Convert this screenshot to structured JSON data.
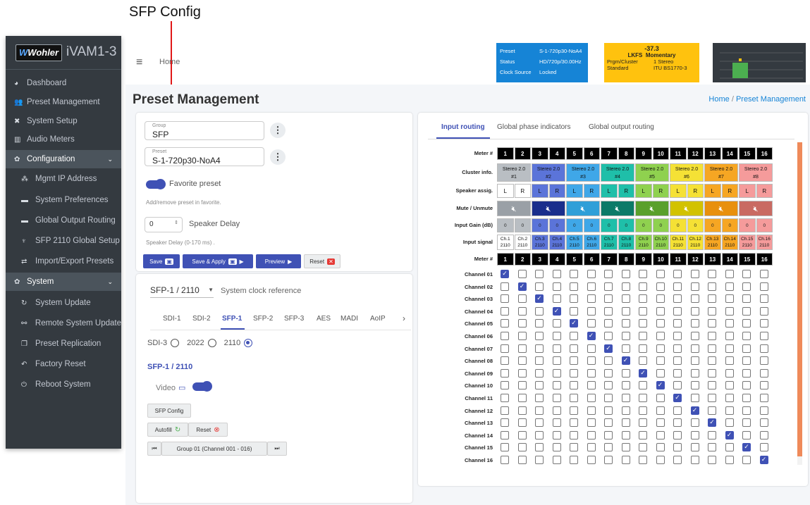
{
  "callout": {
    "title": "SFP Config"
  },
  "sidebar": {
    "brand_logo": "Wohler",
    "app_name": "iVAM1-3",
    "items": [
      {
        "label": "Dashboard",
        "icon": "dashboard-icon",
        "glyph": "◕"
      },
      {
        "label": "Preset Management",
        "icon": "users-icon",
        "glyph": "👥"
      },
      {
        "label": "System Setup",
        "icon": "tools-icon",
        "glyph": "✖"
      },
      {
        "label": "Audio Meters",
        "icon": "meter-icon",
        "glyph": "▥"
      },
      {
        "label": "Configuration",
        "icon": "gear-icon",
        "glyph": "✿",
        "chevron": "⌄"
      },
      {
        "label": "Mgmt IP Address",
        "icon": "network-icon",
        "glyph": "⁂"
      },
      {
        "label": "System Preferences",
        "icon": "keyboard-icon",
        "glyph": "▬"
      },
      {
        "label": "Global Output Routing",
        "icon": "keyboard-icon",
        "glyph": "▬"
      },
      {
        "label": "SFP 2110 Global Setup",
        "icon": "plug-icon",
        "glyph": "♆"
      },
      {
        "label": "Import/Export Presets",
        "icon": "exchange-icon",
        "glyph": "⇄"
      },
      {
        "label": "System",
        "icon": "cogs-icon",
        "glyph": "✿",
        "chevron": "⌄"
      },
      {
        "label": "System Update",
        "icon": "sync-icon",
        "glyph": "↻"
      },
      {
        "label": "Remote System Update",
        "icon": "network-wired-icon",
        "glyph": "⚯"
      },
      {
        "label": "Preset Replication",
        "icon": "copy-icon",
        "glyph": "❐"
      },
      {
        "label": "Factory Reset",
        "icon": "undo-icon",
        "glyph": "↶"
      },
      {
        "label": "Reboot System",
        "icon": "power-icon",
        "glyph": "⏻"
      }
    ]
  },
  "topbar": {
    "home": "Home"
  },
  "status_panel": {
    "rows": [
      {
        "k": "Preset",
        "v": "S-1-720p30-NoA4"
      },
      {
        "k": "Status",
        "v": "HD/720p/30.00Hz"
      },
      {
        "k": "Clock Source",
        "v": "Locked"
      }
    ],
    "color": "#1684d6"
  },
  "loudness_panel": {
    "value": "-37.3",
    "unit": "LKFS",
    "mode": "Momentary",
    "program_label": "Prgm/Cluster",
    "program_value": "1  Stereo",
    "standard_label": "Standard",
    "standard_value": "ITU BS1770-3",
    "color": "#ffc20e"
  },
  "page": {
    "title": "Preset Management",
    "breadcrumb_home": "Home",
    "breadcrumb_sep": "/",
    "breadcrumb_current": "Preset Management"
  },
  "preset_form": {
    "group_label": "Group",
    "group_value": "SFP",
    "preset_label": "Preset",
    "preset_value": "S-1-720p30-NoA4",
    "favorite_label": "Favorite preset",
    "favorite_hint": "Add/remove preset in favorite.",
    "delay_value": "0",
    "delay_label": "Speaker Delay",
    "delay_hint": "Speaker Delay (0-170 ms) .",
    "save": "Save",
    "save_apply": "Save & Apply",
    "preview": "Preview",
    "reset": "Reset"
  },
  "input_config": {
    "clock_value": "SFP-1 / 2110",
    "clock_label": "System clock reference",
    "tabs": [
      "SDI-1",
      "SDI-2",
      "SFP-1",
      "SFP-2",
      "SFP-3",
      "AES",
      "MADI",
      "AoIP"
    ],
    "active_tab": "SFP-1",
    "radios": [
      "SDI-3",
      "2022",
      "2110"
    ],
    "selected_radio": "2110",
    "section_title": "SFP-1 / 2110",
    "video_label": "Video",
    "sfp_config": "SFP Config",
    "autofill": "Autofill",
    "reset": "Reset",
    "pager_label": "Group 01 (Channel 001 - 016)"
  },
  "routing": {
    "tabs": [
      "Input routing",
      "Global phase indicators",
      "Global output routing"
    ],
    "active_tab": "Input routing",
    "row_labels": {
      "meter": "Meter #",
      "cluster": "Cluster info.",
      "speaker": "Speaker assig.",
      "mute": "Mute / Unmute",
      "gain": "Input Gain (dB)",
      "signal": "Input signal",
      "meter2": "Meter #"
    },
    "meters": [
      "1",
      "2",
      "3",
      "4",
      "5",
      "6",
      "7",
      "8",
      "9",
      "10",
      "11",
      "12",
      "13",
      "14",
      "15",
      "16"
    ],
    "clusters": [
      {
        "name": "Stereo 2.0",
        "num": "#1",
        "color": "#b9bec3"
      },
      {
        "name": "Stereo 2.0",
        "num": "#2",
        "color": "#5b74d9"
      },
      {
        "name": "Stereo 2.0",
        "num": "#3",
        "color": "#3fa7e8"
      },
      {
        "name": "Stereo 2.0",
        "num": "#4",
        "color": "#1fbfa9"
      },
      {
        "name": "Stereo 2.0",
        "num": "#5",
        "color": "#8fd14f"
      },
      {
        "name": "Stereo 2.0",
        "num": "#6",
        "color": "#f5e135"
      },
      {
        "name": "Stereo 2.0",
        "num": "#7",
        "color": "#f6a623"
      },
      {
        "name": "Stereo 2.0",
        "num": "#8",
        "color": "#f59b9b"
      }
    ],
    "speakers": [
      "L",
      "R",
      "L",
      "R",
      "L",
      "R",
      "L",
      "R",
      "L",
      "R",
      "L",
      "R",
      "L",
      "R",
      "L",
      "R"
    ],
    "mute_colors": [
      "#9aa0a6",
      "#1a2e8c",
      "#2f9fd8",
      "#0c7a68",
      "#5aa02c",
      "#d2c200",
      "#e8900d",
      "#c96a62"
    ],
    "gains": [
      "0",
      "0",
      "0",
      "0",
      "0",
      "0",
      "0",
      "0",
      "0",
      "0",
      "0",
      "0",
      "0",
      "0",
      "0",
      "0"
    ],
    "signals": [
      "Ch.1",
      "Ch.2",
      "Ch.3",
      "Ch.4",
      "Ch.5",
      "Ch.6",
      "Ch.7",
      "Ch.8",
      "Ch.9",
      "Ch.10",
      "Ch.11",
      "Ch.12",
      "Ch.13",
      "Ch.14",
      "Ch.15",
      "Ch.16"
    ],
    "signal_sub": "2110",
    "channels": [
      "Channel 01",
      "Channel 02",
      "Channel 03",
      "Channel 04",
      "Channel 05",
      "Channel 06",
      "Channel 07",
      "Channel 08",
      "Channel 09",
      "Channel 10",
      "Channel 11",
      "Channel 12",
      "Channel 13",
      "Channel 14",
      "Channel 15",
      "Channel 16"
    ],
    "checked": [
      1,
      2,
      3,
      4,
      5,
      6,
      7,
      8,
      9,
      10,
      11,
      12,
      13,
      14,
      15,
      16
    ]
  }
}
